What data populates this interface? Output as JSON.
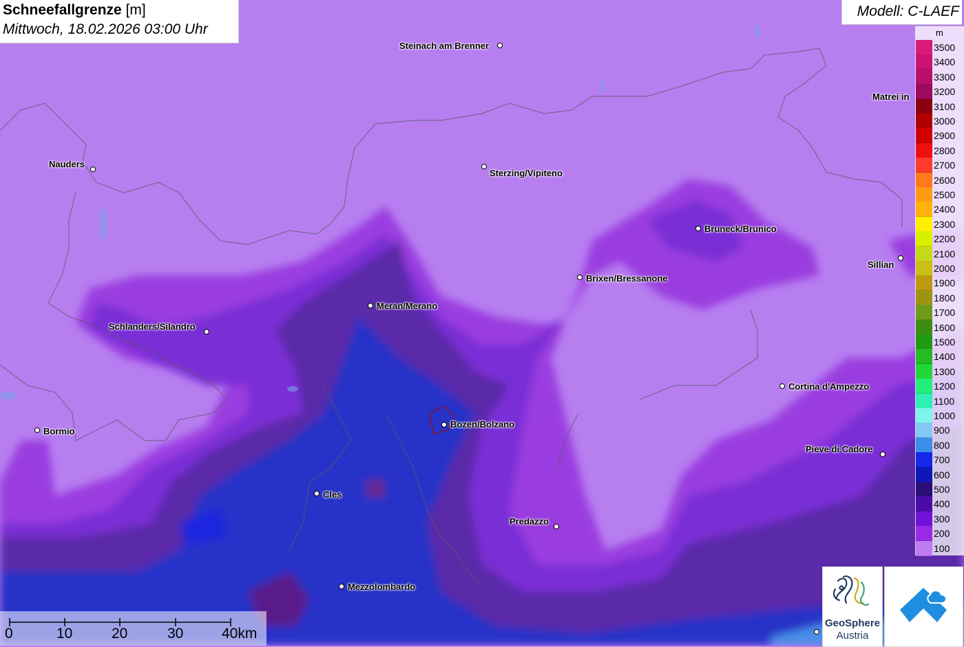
{
  "header": {
    "title": "Schneefallgrenze",
    "unit": "[m]",
    "datetime": "Mittwoch, 18.02.2026 03:00 Uhr"
  },
  "model": {
    "label": "Modell: C-LAEF"
  },
  "legend": {
    "unit": "m",
    "entries": [
      {
        "label": "3500",
        "color": "#d81b7a"
      },
      {
        "label": "3400",
        "color": "#cc1272"
      },
      {
        "label": "3300",
        "color": "#b70f6a"
      },
      {
        "label": "3200",
        "color": "#9c0a60"
      },
      {
        "label": "3100",
        "color": "#8a0010"
      },
      {
        "label": "3000",
        "color": "#b00000"
      },
      {
        "label": "2900",
        "color": "#d10000"
      },
      {
        "label": "2800",
        "color": "#ee1010"
      },
      {
        "label": "2700",
        "color": "#ff3b2a"
      },
      {
        "label": "2600",
        "color": "#ff7a1a"
      },
      {
        "label": "2500",
        "color": "#ff9a14"
      },
      {
        "label": "2400",
        "color": "#ffb20a"
      },
      {
        "label": "2300",
        "color": "#ffee00"
      },
      {
        "label": "2200",
        "color": "#d8f000"
      },
      {
        "label": "2100",
        "color": "#c4d91a"
      },
      {
        "label": "2000",
        "color": "#c8c014"
      },
      {
        "label": "1900",
        "color": "#c09a0e"
      },
      {
        "label": "1800",
        "color": "#9c9412"
      },
      {
        "label": "1700",
        "color": "#6f9a18"
      },
      {
        "label": "1600",
        "color": "#3b8e12"
      },
      {
        "label": "1500",
        "color": "#1f9a14"
      },
      {
        "label": "1400",
        "color": "#24bb24"
      },
      {
        "label": "1300",
        "color": "#22d63a"
      },
      {
        "label": "1200",
        "color": "#24ee7a"
      },
      {
        "label": "1100",
        "color": "#2ef0b4"
      },
      {
        "label": "1000",
        "color": "#7ef4ea"
      },
      {
        "label": "900",
        "color": "#86c6f4"
      },
      {
        "label": "800",
        "color": "#3a8ee8"
      },
      {
        "label": "700",
        "color": "#1428e6"
      },
      {
        "label": "600",
        "color": "#0c18b8"
      },
      {
        "label": "500",
        "color": "#2a0e7a"
      },
      {
        "label": "400",
        "color": "#4a0caa"
      },
      {
        "label": "300",
        "color": "#7012d8"
      },
      {
        "label": "200",
        "color": "#9a2ae6"
      },
      {
        "label": "100",
        "color": "#c07af2"
      }
    ]
  },
  "cities": [
    {
      "name": "Steinach am Brenner"
    },
    {
      "name": "Matrei in"
    },
    {
      "name": "Nauders"
    },
    {
      "name": "Sterzing/Vipiteno"
    },
    {
      "name": "Bruneck/Brunico"
    },
    {
      "name": "Sillian"
    },
    {
      "name": "Brixen/Bressanone"
    },
    {
      "name": "Meran/Merano"
    },
    {
      "name": "Schlanders/Silandro"
    },
    {
      "name": "Cortina d'Ampezzo"
    },
    {
      "name": "Bozen/Bolzano"
    },
    {
      "name": "Bormio"
    },
    {
      "name": "Pieve di Cadore"
    },
    {
      "name": "Cles"
    },
    {
      "name": "Predazzo"
    },
    {
      "name": "Mezzolombardo"
    }
  ],
  "scalebar": {
    "labels": [
      "0",
      "10",
      "20",
      "30",
      "40km"
    ]
  },
  "logos": {
    "geosphere_line1": "GeoSphere",
    "geosphere_line2": "Austria"
  }
}
